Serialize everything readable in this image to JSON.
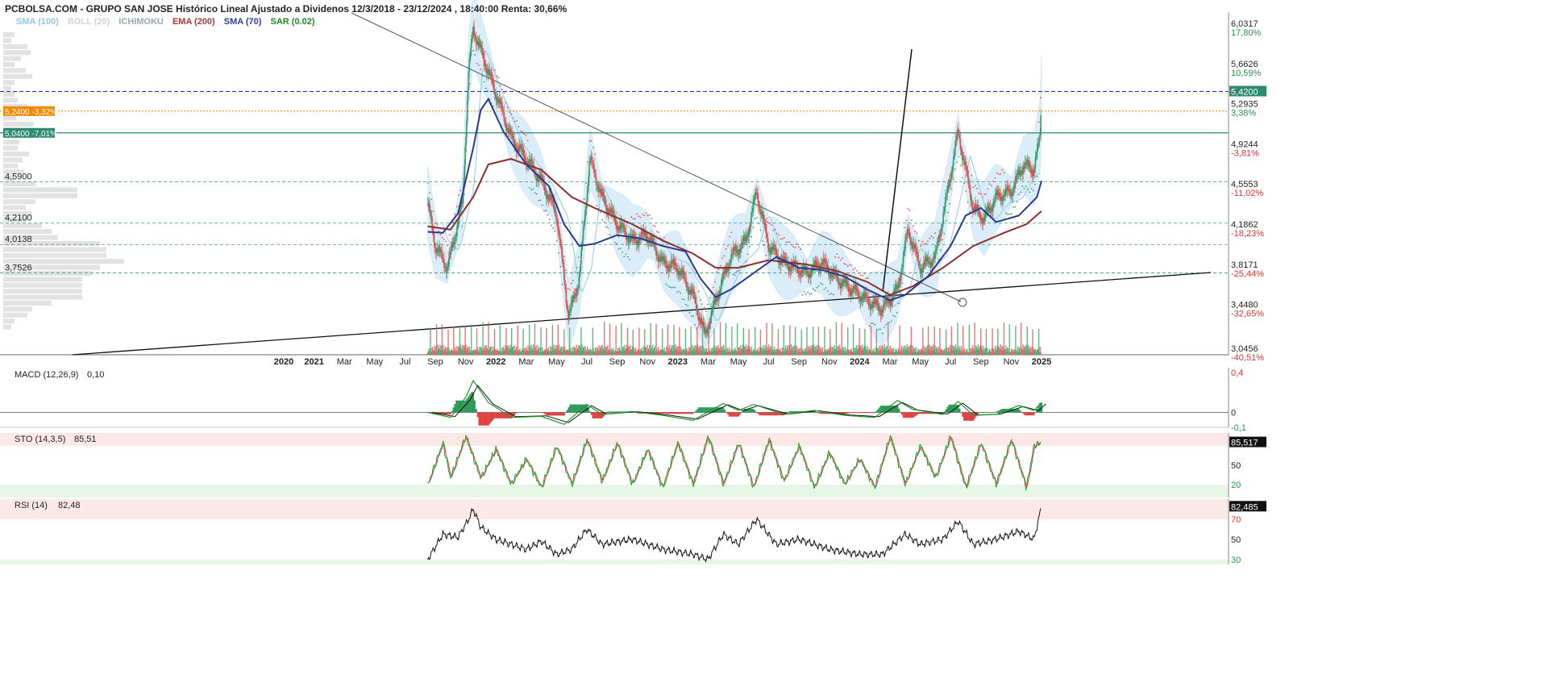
{
  "header": {
    "title": "PCBOLSA.COM - GRUPO SAN JOSE Histórico Lineal Ajustado a Dividenos 12/3/2018 - 23/12/2024 , 18:40:00 Renta: 30,66%"
  },
  "indicators": [
    {
      "label": "SMA (100)",
      "color": "#8fc8ea"
    },
    {
      "label": "BOLL (20)",
      "color": "#cfd6dc"
    },
    {
      "label": "ICHIMOKU",
      "color": "#9aa7b0"
    },
    {
      "label": "EMA (200)",
      "color": "#a33a3a"
    },
    {
      "label": "SMA (70)",
      "color": "#2f3f9a"
    },
    {
      "label": "SAR (0.02)",
      "color": "#1f8a2a"
    }
  ],
  "colors": {
    "up": "#3a9a6a",
    "down": "#d9534f",
    "sma70": "#2a3990",
    "ema200": "#8b2e2e",
    "sma100": "#8fc8ea",
    "band": "#d9ecfa",
    "orange": "#f08a00",
    "teal": "#2e8b70",
    "dark_blue_line": "#1c28b0",
    "panel_red": "#fde8e8",
    "panel_green": "#e6f7e6"
  },
  "price_panel": {
    "right_labels": [
      {
        "price": "6,0317",
        "pct": "17,80%",
        "pct_color": "green",
        "value": 6.0317
      },
      {
        "price": "5,6626",
        "pct": "10,59%",
        "pct_color": "green",
        "value": 5.6626
      },
      {
        "price": "5,2935",
        "pct": "3,38%",
        "pct_color": "green",
        "value": 5.2935
      },
      {
        "price": "4,9244",
        "pct": "-3,81%",
        "pct_color": "red",
        "value": 4.9244
      },
      {
        "price": "4,5553",
        "pct": "-11,02%",
        "pct_color": "red",
        "value": 4.5553
      },
      {
        "price": "4,1862",
        "pct": "-18,23%",
        "pct_color": "red",
        "value": 4.1862
      },
      {
        "price": "3,8171",
        "pct": "-25,44%",
        "pct_color": "red",
        "value": 3.8171
      },
      {
        "price": "3,4480",
        "pct": "-32,65%",
        "pct_color": "red",
        "value": 3.448
      },
      {
        "price": "3,0456",
        "pct": "-40,51%",
        "pct_color": "red",
        "value": 3.0456
      }
    ],
    "current_price_tag": "5,4200",
    "current_price": 5.42,
    "orange_tag": "5,2400 -3,32%",
    "orange_level": 5.24,
    "teal_tag": "5,0400 -7,01%",
    "teal_level": 5.04,
    "left_levels": [
      {
        "label": "4,5900",
        "value": 4.59
      },
      {
        "label": "4,2100",
        "value": 4.21
      },
      {
        "label": "4,0138",
        "value": 4.0138
      },
      {
        "label": "3,7526",
        "value": 3.7526
      }
    ],
    "x_labels": [
      {
        "label": "2020",
        "bold": true
      },
      {
        "label": "2021",
        "bold": true
      },
      {
        "label": "Mar",
        "bold": false
      },
      {
        "label": "May",
        "bold": false
      },
      {
        "label": "Jul",
        "bold": false
      },
      {
        "label": "Sep",
        "bold": false
      },
      {
        "label": "Nov",
        "bold": false
      },
      {
        "label": "2022",
        "bold": true
      },
      {
        "label": "Mar",
        "bold": false
      },
      {
        "label": "May",
        "bold": false
      },
      {
        "label": "Jul",
        "bold": false
      },
      {
        "label": "Sep",
        "bold": false
      },
      {
        "label": "Nov",
        "bold": false
      },
      {
        "label": "2023",
        "bold": true
      },
      {
        "label": "Mar",
        "bold": false
      },
      {
        "label": "May",
        "bold": false
      },
      {
        "label": "Jul",
        "bold": false
      },
      {
        "label": "Sep",
        "bold": false
      },
      {
        "label": "Nov",
        "bold": false
      },
      {
        "label": "2024",
        "bold": true
      },
      {
        "label": "Mar",
        "bold": false
      },
      {
        "label": "May",
        "bold": false
      },
      {
        "label": "Jul",
        "bold": false
      },
      {
        "label": "Sep",
        "bold": false
      },
      {
        "label": "Nov",
        "bold": false
      },
      {
        "label": "2025",
        "bold": true
      }
    ]
  },
  "macd_panel": {
    "label": "MACD (12,26,9)",
    "value": "0,10",
    "axis": [
      "0,4",
      "0",
      "-0,1"
    ]
  },
  "sto_panel": {
    "label": "STO (14,3,5)",
    "value": "85,51",
    "current_tag": "85,517",
    "axis": [
      "50",
      "20"
    ]
  },
  "rsi_panel": {
    "label": "RSI (14)",
    "value": "82,48",
    "current_tag": "82,485",
    "axis": [
      "70",
      "50",
      "30"
    ]
  },
  "chart_data": {
    "type": "line",
    "title": "PCBOLSA.COM - GRUPO SAN JOSE Histórico Lineal Ajustado a Dividenos 12/3/2018 - 23/12/2024 , 18:40:00 Renta: 30,66%",
    "x_range": [
      "2020",
      "2025"
    ],
    "ylim": [
      3.0,
      6.15
    ],
    "grid": false,
    "series": [
      {
        "name": "SMA (70)",
        "values": [
          [
            2020.95,
            4.13
          ],
          [
            2021.05,
            4.12
          ],
          [
            2021.15,
            4.3
          ],
          [
            2021.25,
            4.9
          ],
          [
            2021.3,
            5.25
          ],
          [
            2021.35,
            5.35
          ],
          [
            2021.45,
            5.05
          ],
          [
            2021.6,
            4.75
          ],
          [
            2021.75,
            4.55
          ],
          [
            2021.85,
            4.2
          ],
          [
            2021.95,
            4.0
          ],
          [
            2022.05,
            4.02
          ],
          [
            2022.2,
            4.1
          ],
          [
            2022.35,
            4.07
          ],
          [
            2022.5,
            4.0
          ],
          [
            2022.65,
            3.95
          ],
          [
            2022.75,
            3.7
          ],
          [
            2022.85,
            3.53
          ],
          [
            2022.95,
            3.6
          ],
          [
            2023.1,
            3.75
          ],
          [
            2023.25,
            3.9
          ],
          [
            2023.4,
            3.8
          ],
          [
            2023.55,
            3.78
          ],
          [
            2023.7,
            3.72
          ],
          [
            2023.85,
            3.6
          ],
          [
            2024.0,
            3.5
          ],
          [
            2024.1,
            3.55
          ],
          [
            2024.25,
            3.72
          ],
          [
            2024.4,
            4.0
          ],
          [
            2024.5,
            4.28
          ],
          [
            2024.6,
            4.35
          ],
          [
            2024.7,
            4.22
          ],
          [
            2024.85,
            4.28
          ],
          [
            2024.97,
            4.45
          ],
          [
            2025.0,
            4.6
          ]
        ]
      },
      {
        "name": "EMA (200)",
        "values": [
          [
            2020.95,
            4.18
          ],
          [
            2021.1,
            4.15
          ],
          [
            2021.25,
            4.45
          ],
          [
            2021.35,
            4.75
          ],
          [
            2021.5,
            4.8
          ],
          [
            2021.7,
            4.7
          ],
          [
            2021.9,
            4.45
          ],
          [
            2022.05,
            4.35
          ],
          [
            2022.3,
            4.2
          ],
          [
            2022.5,
            4.05
          ],
          [
            2022.7,
            3.93
          ],
          [
            2022.85,
            3.8
          ],
          [
            2023.0,
            3.8
          ],
          [
            2023.2,
            3.87
          ],
          [
            2023.45,
            3.83
          ],
          [
            2023.65,
            3.77
          ],
          [
            2023.85,
            3.67
          ],
          [
            2024.0,
            3.55
          ],
          [
            2024.15,
            3.63
          ],
          [
            2024.35,
            3.8
          ],
          [
            2024.55,
            4.0
          ],
          [
            2024.75,
            4.12
          ],
          [
            2024.9,
            4.2
          ],
          [
            2025.0,
            4.32
          ]
        ]
      },
      {
        "name": "Price",
        "values": [
          [
            2020.95,
            4.4
          ],
          [
            2021.0,
            4.0
          ],
          [
            2021.08,
            3.8
          ],
          [
            2021.18,
            4.4
          ],
          [
            2021.22,
            5.6
          ],
          [
            2021.25,
            6.0
          ],
          [
            2021.3,
            5.8
          ],
          [
            2021.4,
            5.4
          ],
          [
            2021.5,
            5.0
          ],
          [
            2021.6,
            4.8
          ],
          [
            2021.7,
            4.6
          ],
          [
            2021.8,
            4.3
          ],
          [
            2021.88,
            3.35
          ],
          [
            2021.95,
            3.7
          ],
          [
            2022.02,
            4.8
          ],
          [
            2022.1,
            4.45
          ],
          [
            2022.2,
            4.2
          ],
          [
            2022.3,
            4.05
          ],
          [
            2022.4,
            4.1
          ],
          [
            2022.5,
            3.85
          ],
          [
            2022.6,
            3.8
          ],
          [
            2022.7,
            3.55
          ],
          [
            2022.78,
            3.18
          ],
          [
            2022.85,
            3.5
          ],
          [
            2022.95,
            3.9
          ],
          [
            2023.05,
            4.05
          ],
          [
            2023.12,
            4.5
          ],
          [
            2023.2,
            4.0
          ],
          [
            2023.3,
            3.85
          ],
          [
            2023.45,
            3.75
          ],
          [
            2023.55,
            3.85
          ],
          [
            2023.65,
            3.7
          ],
          [
            2023.75,
            3.6
          ],
          [
            2023.85,
            3.5
          ],
          [
            2023.95,
            3.42
          ],
          [
            2024.05,
            3.6
          ],
          [
            2024.12,
            4.15
          ],
          [
            2024.2,
            3.8
          ],
          [
            2024.3,
            3.9
          ],
          [
            2024.38,
            4.5
          ],
          [
            2024.45,
            5.05
          ],
          [
            2024.55,
            4.35
          ],
          [
            2024.62,
            4.25
          ],
          [
            2024.7,
            4.45
          ],
          [
            2024.8,
            4.5
          ],
          [
            2024.88,
            4.75
          ],
          [
            2024.95,
            4.7
          ],
          [
            2024.99,
            5.0
          ],
          [
            2025.0,
            5.42
          ]
        ]
      }
    ],
    "macd": {
      "ylim": [
        -0.15,
        0.45
      ],
      "values": [
        [
          2020.95,
          0.0
        ],
        [
          2021.1,
          -0.05
        ],
        [
          2021.2,
          0.15
        ],
        [
          2021.25,
          0.32
        ],
        [
          2021.35,
          0.1
        ],
        [
          2021.5,
          -0.05
        ],
        [
          2021.7,
          -0.04
        ],
        [
          2021.85,
          -0.12
        ],
        [
          2022.0,
          0.08
        ],
        [
          2022.1,
          -0.02
        ],
        [
          2022.3,
          0.01
        ],
        [
          2022.5,
          -0.03
        ],
        [
          2022.7,
          -0.08
        ],
        [
          2022.9,
          0.09
        ],
        [
          2023.0,
          0.02
        ],
        [
          2023.1,
          0.08
        ],
        [
          2023.3,
          -0.02
        ],
        [
          2023.5,
          0.02
        ],
        [
          2023.7,
          -0.03
        ],
        [
          2023.9,
          -0.05
        ],
        [
          2024.05,
          0.12
        ],
        [
          2024.15,
          0.03
        ],
        [
          2024.35,
          -0.02
        ],
        [
          2024.45,
          0.11
        ],
        [
          2024.55,
          -0.03
        ],
        [
          2024.7,
          -0.02
        ],
        [
          2024.85,
          0.07
        ],
        [
          2024.95,
          0.02
        ],
        [
          2025.0,
          0.1
        ]
      ]
    },
    "sto": {
      "ylim": [
        0,
        100
      ],
      "values": [
        [
          2020.95,
          20
        ],
        [
          2021.05,
          85
        ],
        [
          2021.1,
          30
        ],
        [
          2021.2,
          95
        ],
        [
          2021.3,
          30
        ],
        [
          2021.4,
          75
        ],
        [
          2021.5,
          20
        ],
        [
          2021.6,
          60
        ],
        [
          2021.7,
          15
        ],
        [
          2021.8,
          80
        ],
        [
          2021.9,
          20
        ],
        [
          2022.0,
          90
        ],
        [
          2022.1,
          25
        ],
        [
          2022.2,
          85
        ],
        [
          2022.3,
          20
        ],
        [
          2022.4,
          75
        ],
        [
          2022.5,
          15
        ],
        [
          2022.6,
          85
        ],
        [
          2022.7,
          20
        ],
        [
          2022.8,
          95
        ],
        [
          2022.9,
          20
        ],
        [
          2023.0,
          85
        ],
        [
          2023.1,
          15
        ],
        [
          2023.2,
          90
        ],
        [
          2023.3,
          25
        ],
        [
          2023.4,
          80
        ],
        [
          2023.5,
          15
        ],
        [
          2023.6,
          70
        ],
        [
          2023.7,
          20
        ],
        [
          2023.8,
          60
        ],
        [
          2023.9,
          15
        ],
        [
          2024.0,
          95
        ],
        [
          2024.1,
          20
        ],
        [
          2024.2,
          80
        ],
        [
          2024.3,
          30
        ],
        [
          2024.4,
          95
        ],
        [
          2024.5,
          15
        ],
        [
          2024.6,
          85
        ],
        [
          2024.7,
          20
        ],
        [
          2024.8,
          90
        ],
        [
          2024.9,
          15
        ],
        [
          2024.95,
          80
        ],
        [
          2025.0,
          85.5
        ]
      ]
    },
    "rsi": {
      "ylim": [
        25,
        90
      ],
      "values": [
        [
          2020.95,
          30
        ],
        [
          2021.05,
          55
        ],
        [
          2021.15,
          52
        ],
        [
          2021.22,
          70
        ],
        [
          2021.25,
          80
        ],
        [
          2021.3,
          62
        ],
        [
          2021.4,
          50
        ],
        [
          2021.5,
          45
        ],
        [
          2021.6,
          40
        ],
        [
          2021.7,
          48
        ],
        [
          2021.8,
          35
        ],
        [
          2021.9,
          40
        ],
        [
          2022.0,
          60
        ],
        [
          2022.1,
          45
        ],
        [
          2022.3,
          50
        ],
        [
          2022.5,
          40
        ],
        [
          2022.7,
          35
        ],
        [
          2022.8,
          30
        ],
        [
          2022.9,
          55
        ],
        [
          2023.0,
          45
        ],
        [
          2023.12,
          70
        ],
        [
          2023.25,
          45
        ],
        [
          2023.4,
          50
        ],
        [
          2023.6,
          40
        ],
        [
          2023.8,
          35
        ],
        [
          2023.95,
          35
        ],
        [
          2024.1,
          55
        ],
        [
          2024.2,
          45
        ],
        [
          2024.35,
          50
        ],
        [
          2024.45,
          68
        ],
        [
          2024.55,
          45
        ],
        [
          2024.7,
          50
        ],
        [
          2024.85,
          58
        ],
        [
          2024.95,
          50
        ],
        [
          2025.0,
          82.5
        ]
      ]
    }
  }
}
